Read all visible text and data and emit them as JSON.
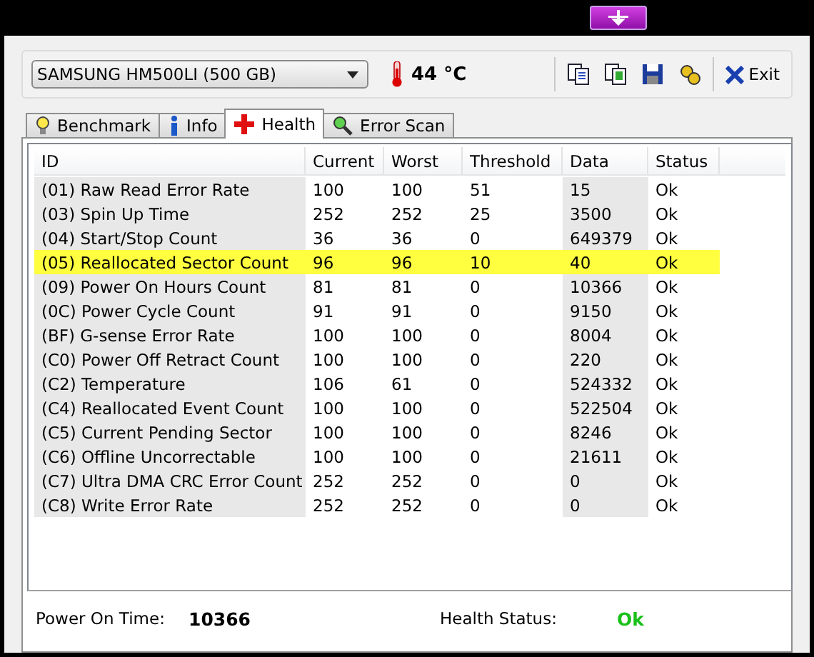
{
  "toolbar": {
    "device": "SAMSUNG HM500LI (500 GB)",
    "temperature": "44 °C",
    "exit_label": "Exit"
  },
  "tabs": [
    {
      "label": "Benchmark",
      "selected": false
    },
    {
      "label": "Info",
      "selected": false
    },
    {
      "label": "Health",
      "selected": true
    },
    {
      "label": "Error Scan",
      "selected": false
    }
  ],
  "table": {
    "columns": [
      "ID",
      "Current",
      "Worst",
      "Threshold",
      "Data",
      "Status"
    ],
    "rows": [
      {
        "cells": [
          "(01) Raw Read Error Rate",
          "100",
          "100",
          "51",
          "15",
          "Ok"
        ],
        "highlighted": false
      },
      {
        "cells": [
          "(03) Spin Up Time",
          "252",
          "252",
          "25",
          "3500",
          "Ok"
        ],
        "highlighted": false
      },
      {
        "cells": [
          "(04) Start/Stop Count",
          "36",
          "36",
          "0",
          "649379",
          "Ok"
        ],
        "highlighted": false
      },
      {
        "cells": [
          "(05) Reallocated Sector Count",
          "96",
          "96",
          "10",
          "40",
          "Ok"
        ],
        "highlighted": true
      },
      {
        "cells": [
          "(09) Power On Hours Count",
          "81",
          "81",
          "0",
          "10366",
          "Ok"
        ],
        "highlighted": false
      },
      {
        "cells": [
          "(0C) Power Cycle Count",
          "91",
          "91",
          "0",
          "9150",
          "Ok"
        ],
        "highlighted": false
      },
      {
        "cells": [
          "(BF) G-sense Error Rate",
          "100",
          "100",
          "0",
          "8004",
          "Ok"
        ],
        "highlighted": false
      },
      {
        "cells": [
          "(C0) Power Off Retract Count",
          "100",
          "100",
          "0",
          "220",
          "Ok"
        ],
        "highlighted": false
      },
      {
        "cells": [
          "(C2) Temperature",
          "106",
          "61",
          "0",
          "524332",
          "Ok"
        ],
        "highlighted": false
      },
      {
        "cells": [
          "(C4) Reallocated Event Count",
          "100",
          "100",
          "0",
          "522504",
          "Ok"
        ],
        "highlighted": false
      },
      {
        "cells": [
          "(C5) Current Pending Sector",
          "100",
          "100",
          "0",
          "8246",
          "Ok"
        ],
        "highlighted": false
      },
      {
        "cells": [
          "(C6) Offline Uncorrectable",
          "100",
          "100",
          "0",
          "21611",
          "Ok"
        ],
        "highlighted": false
      },
      {
        "cells": [
          "(C7) Ultra DMA CRC Error Count",
          "252",
          "252",
          "0",
          "0",
          "Ok"
        ],
        "highlighted": false
      },
      {
        "cells": [
          "(C8) Write Error Rate",
          "252",
          "252",
          "0",
          "0",
          "Ok"
        ],
        "highlighted": false
      }
    ]
  },
  "footer": {
    "power_on_label": "Power On Time:",
    "power_on_value": "10366",
    "health_label": "Health Status:",
    "health_value": "Ok"
  }
}
